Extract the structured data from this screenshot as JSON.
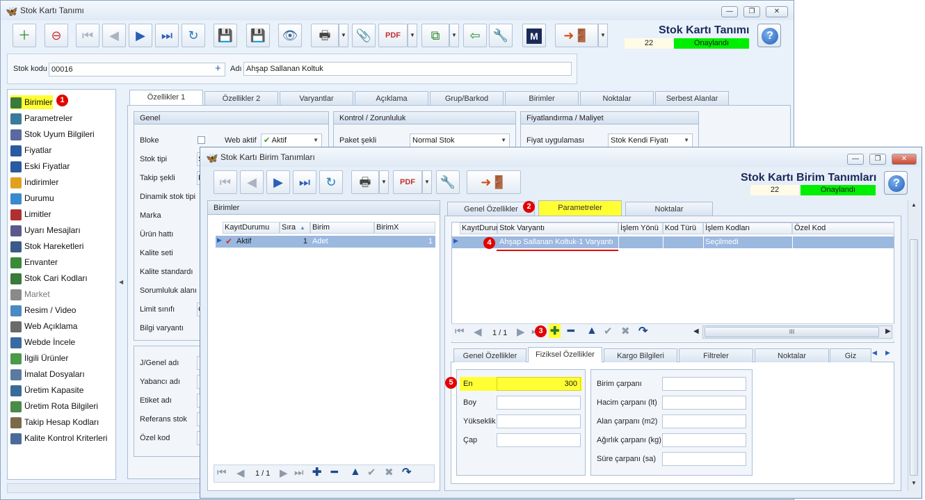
{
  "main_window": {
    "title": "Stok Kartı Tanımı",
    "header_title": "Stok Kartı Tanımı",
    "record_number": "22",
    "status": "Onaylandı",
    "help": "?",
    "logo_letter": "M",
    "stok_kodu_label": "Stok kodu",
    "stok_kodu_value": "00016",
    "adi_label": "Adı",
    "adi_value": "Ahşap Sallanan Koltuk"
  },
  "sidebar": {
    "items": [
      {
        "label": "Birimler",
        "color": "#3a7a3a"
      },
      {
        "label": "Parametreler",
        "color": "#3a7a9a"
      },
      {
        "label": "Stok Uyum Bilgileri",
        "color": "#5a6aa0"
      },
      {
        "label": "Fiyatlar",
        "color": "#2a5aa0"
      },
      {
        "label": "Eski Fiyatlar",
        "color": "#2a5aa0"
      },
      {
        "label": "İndirimler",
        "color": "#e0a020"
      },
      {
        "label": "Durumu",
        "color": "#3a8ad0"
      },
      {
        "label": "Limitler",
        "color": "#b03030"
      },
      {
        "label": "Uyarı Mesajları",
        "color": "#5a5a8a"
      },
      {
        "label": "Stok Hareketleri",
        "color": "#3a5a8a"
      },
      {
        "label": "Envanter",
        "color": "#3a8a3a"
      },
      {
        "label": "Stok Cari Kodları",
        "color": "#3a7a3a"
      },
      {
        "label": "Market",
        "color": "#8a8a8a"
      },
      {
        "label": "Resim / Video",
        "color": "#4a8ac0"
      },
      {
        "label": "Web Açıklama",
        "color": "#6a6a6a"
      },
      {
        "label": "Webde İncele",
        "color": "#3a6aa0"
      },
      {
        "label": "İlgili Ürünler",
        "color": "#4a9a4a"
      },
      {
        "label": "İmalat Dosyaları",
        "color": "#5a7aa0"
      },
      {
        "label": "Üretim Kapasite",
        "color": "#3a6a9a"
      },
      {
        "label": "Üretim Rota Bilgileri",
        "color": "#4a8a4a"
      },
      {
        "label": "Takip Hesap Kodları",
        "color": "#7a6a4a"
      },
      {
        "label": "Kalite Kontrol Kriterleri",
        "color": "#4a6a9a"
      }
    ],
    "highlight_color": "#ffff33"
  },
  "main_tabs": [
    "Özellikler 1",
    "Özellikler 2",
    "Varyantlar",
    "Açıklama",
    "Grup/Barkod",
    "Birimler",
    "Noktalar",
    "Serbest Alanlar"
  ],
  "genel": {
    "title": "Genel",
    "bloke": "Bloke",
    "web_aktif": "Web aktif",
    "web_aktif_value": "Aktif",
    "fields": [
      "Stok tipi",
      "Takip şekli",
      "Dinamik stok tipi",
      "Marka",
      "Ürün hattı",
      "Kalite seti",
      "Kalite standardı",
      "Sorumluluk alanı",
      "Limit sınıfı",
      "Bilgi varyantı"
    ],
    "fields2": [
      "J/Genel adı",
      "Yabancı adı",
      "Etiket adı",
      "Referans stok",
      "Özel kod"
    ],
    "stok_tipi_partial": "S",
    "takip_partial": "F",
    "limit_partial": "G"
  },
  "kontrol": {
    "title": "Kontrol / Zorunluluk",
    "paket_label": "Paket şekli",
    "paket_value": "Normal Stok"
  },
  "fiyat": {
    "title": "Fiyatlandırma / Maliyet",
    "uyg_label": "Fiyat uygulaması",
    "uyg_value": "Stok Kendi Fiyatı"
  },
  "dialog": {
    "title": "Stok Kartı Birim Tanımları",
    "header_title": "Stok Kartı Birim Tanımları",
    "record_number": "22",
    "status": "Onaylandı",
    "help": "?",
    "birimler_title": "Birimler",
    "birimler_columns": [
      "KayıtDurumu",
      "Sıra",
      "Birim",
      "BirimX"
    ],
    "birimler_row": {
      "durum": "Aktif",
      "sira": "1",
      "birim": "Adet",
      "birimx": "1"
    },
    "birimler_page": "1 / 1",
    "right_tabs": [
      "Genel Özellikler",
      "Parametreler",
      "Noktalar"
    ],
    "param_columns": [
      "KayıtDurum",
      "Stok Varyantı",
      "İşlem Yönü",
      "Kod Türü",
      "İşlem Kodları",
      "Özel Kod"
    ],
    "param_row": {
      "varyant": "Ahşap Sallanan Koltuk-1 Varyantı",
      "islem_kodlari": "Seçilmedi"
    },
    "param_page": "1 / 1",
    "scroll_thumb": "III",
    "bottom_tabs": [
      "Genel Özellikler",
      "Fiziksel Özellikler",
      "Kargo Bilgileri",
      "Filtreler",
      "Noktalar",
      "Giz"
    ],
    "fiziksel_left": [
      {
        "label": "En",
        "value": "300"
      },
      {
        "label": "Boy",
        "value": ""
      },
      {
        "label": "Yükseklik",
        "value": ""
      },
      {
        "label": "Çap",
        "value": ""
      }
    ],
    "fiziksel_right": [
      {
        "label": "Birim çarpanı",
        "value": ""
      },
      {
        "label": "Hacim çarpanı (lt)",
        "value": ""
      },
      {
        "label": "Alan çarpanı (m2)",
        "value": ""
      },
      {
        "label": "Ağırlık çarpanı (kg)",
        "value": ""
      },
      {
        "label": "Süre çarpanı (sa)",
        "value": ""
      }
    ]
  },
  "markers": [
    "1",
    "2",
    "3",
    "4",
    "5"
  ],
  "colors": {
    "approved": "#00ee00",
    "highlight": "#ffff33",
    "marker": "#e30000",
    "selection": "#9bb8df"
  }
}
